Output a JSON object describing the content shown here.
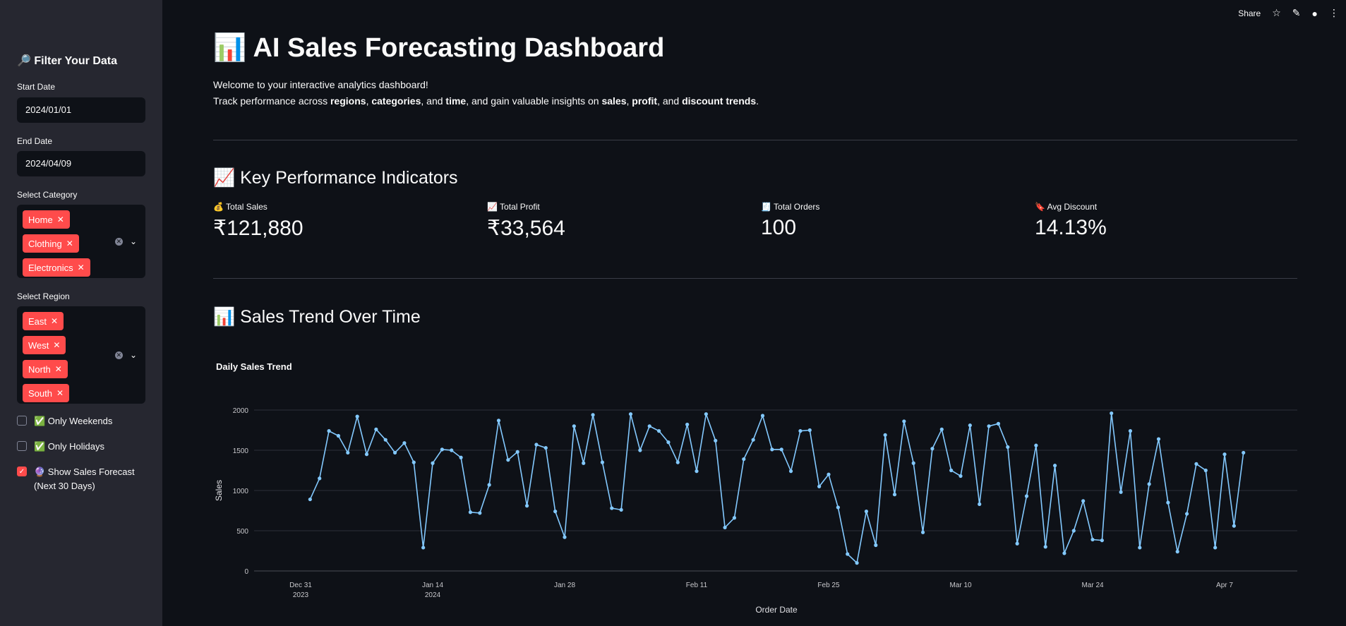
{
  "sidebar": {
    "title": "🔎 Filter Your Data",
    "start_date": {
      "label": "Start Date",
      "value": "2024/01/01"
    },
    "end_date": {
      "label": "End Date",
      "value": "2024/04/09"
    },
    "category": {
      "label": "Select Category",
      "chips": [
        "Home",
        "Clothing",
        "Electronics"
      ]
    },
    "region": {
      "label": "Select Region",
      "chips": [
        "East",
        "West",
        "North",
        "South"
      ]
    },
    "checks": [
      {
        "label": "✅ Only Weekends",
        "checked": false
      },
      {
        "label": "✅ Only Holidays",
        "checked": false
      },
      {
        "label": "🔮 Show Sales Forecast (Next 30 Days)",
        "checked": true
      }
    ]
  },
  "toolbar": {
    "share_label": "Share"
  },
  "main": {
    "title": "📊 AI Sales Forecasting Dashboard",
    "intro_line1": "Welcome to your interactive analytics dashboard!",
    "intro_line2": {
      "p1": "Track performance across ",
      "b1": "regions",
      "p2": ", ",
      "b2": "categories",
      "p3": ", and ",
      "b3": "time",
      "p4": ", and gain valuable insights on ",
      "b4": "sales",
      "p5": ", ",
      "b5": "profit",
      "p6": ", and ",
      "b6": "discount trends",
      "p7": "."
    },
    "kpi_heading": "📈 Key Performance Indicators",
    "kpis": [
      {
        "label": "💰 Total Sales",
        "value": "₹121,880"
      },
      {
        "label": "📈 Total Profit",
        "value": "₹33,564"
      },
      {
        "label": "🧾 Total Orders",
        "value": "100"
      },
      {
        "label": "🔖 Avg Discount",
        "value": "14.13%"
      }
    ],
    "trend_heading": "📊 Sales Trend Over Time"
  },
  "colors": {
    "accent": "#ff4b4b",
    "line": "#83c9ff",
    "bg": "#0e1117",
    "sidebar": "#262730"
  },
  "chart_data": {
    "type": "line",
    "title": "Daily Sales Trend",
    "xlabel": "Order Date",
    "ylabel": "Sales",
    "ylim": [
      0,
      2000
    ],
    "yticks": [
      0,
      500,
      1000,
      1500,
      2000
    ],
    "xticks": [
      {
        "date": "2023-12-31",
        "label": "Dec 31",
        "sub": "2023"
      },
      {
        "date": "2024-01-14",
        "label": "Jan 14",
        "sub": "2024"
      },
      {
        "date": "2024-01-28",
        "label": "Jan 28",
        "sub": ""
      },
      {
        "date": "2024-02-11",
        "label": "Feb 11",
        "sub": ""
      },
      {
        "date": "2024-02-25",
        "label": "Feb 25",
        "sub": ""
      },
      {
        "date": "2024-03-10",
        "label": "Mar 10",
        "sub": ""
      },
      {
        "date": "2024-03-24",
        "label": "Mar 24",
        "sub": ""
      },
      {
        "date": "2024-04-07",
        "label": "Apr 7",
        "sub": ""
      }
    ],
    "grid": true,
    "start_date": "2024-01-01",
    "values": [
      890,
      1150,
      1740,
      1680,
      1470,
      1920,
      1450,
      1760,
      1630,
      1470,
      1590,
      1350,
      290,
      1340,
      1510,
      1500,
      1410,
      730,
      720,
      1070,
      1870,
      1380,
      1480,
      810,
      1570,
      1530,
      740,
      420,
      1800,
      1340,
      1940,
      1350,
      780,
      760,
      1950,
      1500,
      1800,
      1740,
      1600,
      1350,
      1820,
      1240,
      1950,
      1620,
      540,
      660,
      1390,
      1630,
      1930,
      1510,
      1510,
      1240,
      1740,
      1750,
      1050,
      1200,
      790,
      210,
      100,
      740,
      320,
      1690,
      950,
      1860,
      1340,
      480,
      1520,
      1760,
      1250,
      1180,
      1810,
      830,
      1800,
      1830,
      1540,
      340,
      930,
      1560,
      300,
      1310,
      220,
      500,
      870,
      390,
      380,
      1960,
      980,
      1740,
      290,
      1080,
      1640,
      850,
      240,
      710,
      1330,
      1250,
      290,
      1450,
      560,
      1470
    ]
  }
}
